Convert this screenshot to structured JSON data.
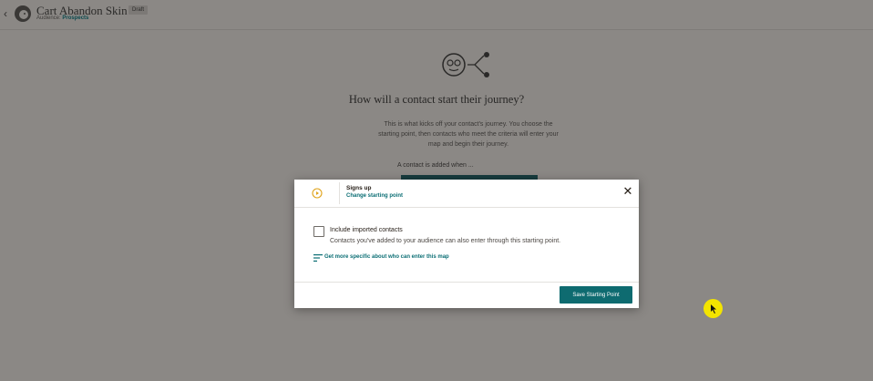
{
  "header": {
    "title": "Cart Abandon Skin 1",
    "badge": "Draft",
    "audience_label": "Audience:",
    "audience_value": "Prospects",
    "back_icon": "chevron-left-icon",
    "logo_icon": "mailchimp-logo-icon"
  },
  "main": {
    "icon": "journey-start-icon",
    "title": "How will a contact start their journey?",
    "description": "This is what kicks off your contact's journey. You choose the starting point, then contacts who meet the criteria will enter your map and begin their journey.",
    "contact_label": "A contact is added when ..."
  },
  "modal": {
    "icon": "play-circle-icon",
    "title": "Signs up",
    "change_link": "Change starting point",
    "close_icon": "close-icon",
    "checkbox_label": "Include imported contacts",
    "checkbox_checked": false,
    "checkbox_help": "Contacts you've added to your audience can also enter through this starting point.",
    "filter_icon": "filter-lines-icon",
    "specific_link": "Get more specific about who can enter this map",
    "save_label": "Save Starting Point"
  },
  "colors": {
    "teal": "#0e6b70",
    "play_icon": "#e0a319",
    "cursor_highlight": "#f3e400"
  }
}
